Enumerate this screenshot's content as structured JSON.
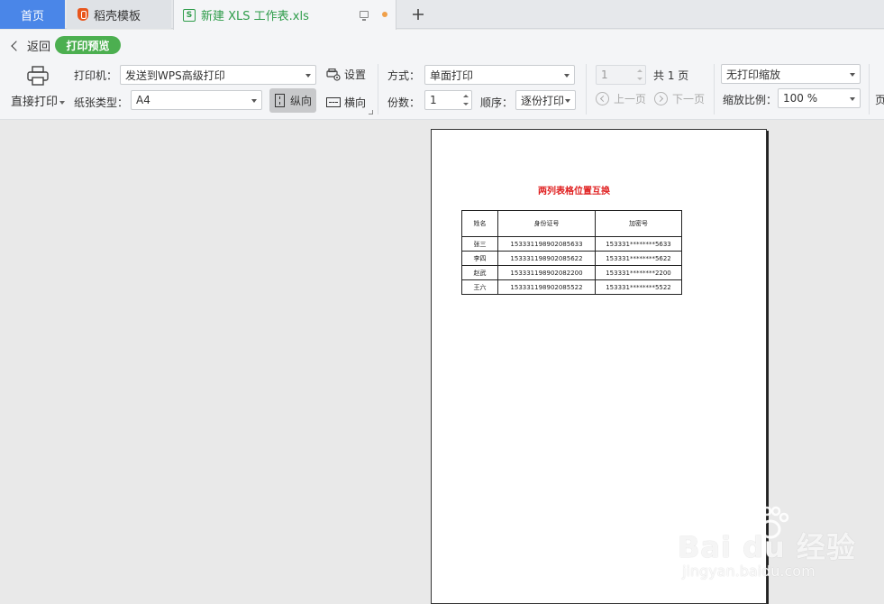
{
  "tabs": {
    "home": "首页",
    "daoke": "稻壳模板",
    "doc": "新建 XLS 工作表.xls",
    "doc_icon_letter": "S"
  },
  "toolbar": {
    "back": "返回",
    "preview": "打印预览",
    "direct_print": "直接打印",
    "printer_label": "打印机：",
    "printer_value": "发送到WPS高级打印",
    "settings": "设置",
    "paper_label": "纸张类型：",
    "paper_value": "A4",
    "portrait": "纵向",
    "landscape": "横向",
    "mode_label": "方式：",
    "mode_value": "单面打印",
    "copies_label": "份数：",
    "copies_value": "1",
    "order_label": "顺序：",
    "order_value": "逐份打印",
    "page_value": "1",
    "page_total": "共 1 页",
    "prev_page": "上一页",
    "next_page": "下一页",
    "scale_mode": "无打印缩放",
    "scale_label": "缩放比例：",
    "scale_value": "100 %",
    "cut_label": "页"
  },
  "sheet": {
    "title": "两列表格位置互换",
    "headers": [
      "姓名",
      "身份证号",
      "加密号"
    ],
    "rows": [
      [
        "张三",
        "153331198902085633",
        "153331********5633"
      ],
      [
        "李四",
        "153331198902085622",
        "153331********5622"
      ],
      [
        "赵武",
        "153331198902082200",
        "153331********2200"
      ],
      [
        "王六",
        "153331198902085522",
        "153331********5522"
      ]
    ]
  },
  "watermark": {
    "main": "Bai du 经验",
    "sub": "jingyan.baidu.com"
  },
  "colors": {
    "tab_home": "#4a86e8",
    "preview_pill": "#4caf50",
    "doc_tab_text": "#2e9c4a",
    "title_red": "#e02020"
  }
}
